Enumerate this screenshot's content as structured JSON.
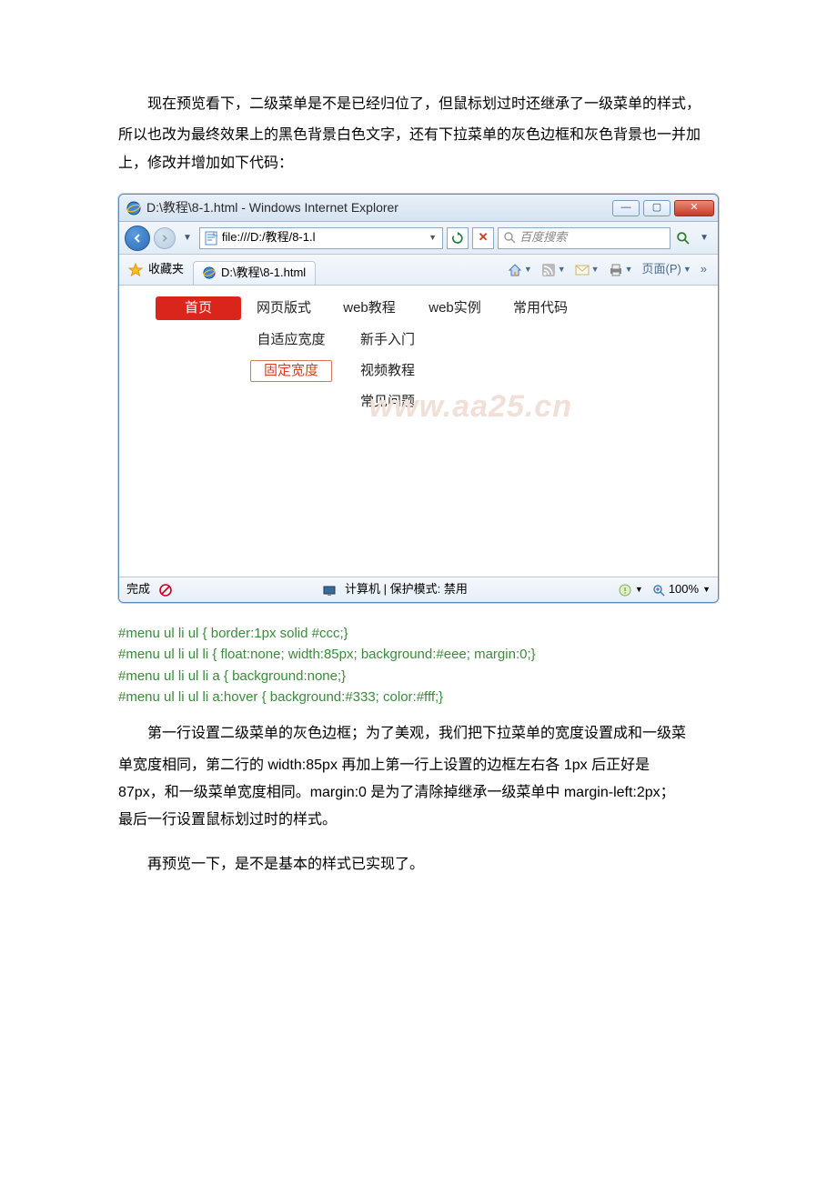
{
  "paragraphs": {
    "p1a": "现在预览看下，二级菜单是不是已经归位了，但鼠标划过时还继承了一级菜单的样式，",
    "p1b": "所以也改为最终效果上的黑色背景白色文字，还有下拉菜单的灰色边框和灰色背景也一并加",
    "p1c": "上，修改并增加如下代码：",
    "p2a": "第一行设置二级菜单的灰色边框；为了美观，我们把下拉菜单的宽度设置成和一级菜",
    "p2b": "单宽度相同，第二行的 width:85px 再加上第一行上设置的边框左右各 1px 后正好是",
    "p2c": "87px，和一级菜单宽度相同。margin:0 是为了清除掉继承一级菜单中 margin-left:2px；",
    "p2d": "最后一行设置鼠标划过时的样式。",
    "p3": "再预览一下，是不是基本的样式已实现了。"
  },
  "iewin": {
    "title": "D:\\教程\\8-1.html - Windows Internet Explorer",
    "address": "file:///D:/教程/8-1.l",
    "search_placeholder": "百度搜索",
    "fav_label": "收藏夹",
    "tab_label": "D:\\教程\\8-1.html",
    "page_menu": "页面(P)",
    "status_done": "完成",
    "status_zone": "计算机 | 保护模式: 禁用",
    "zoom": "100%"
  },
  "menu": {
    "items": [
      "首页",
      "网页版式",
      "web教程",
      "web实例",
      "常用代码"
    ],
    "sub_a": [
      "自适应宽度",
      "固定宽度"
    ],
    "sub_b": [
      "新手入门",
      "视频教程",
      "常见问题"
    ]
  },
  "watermark": "www.aa25.cn",
  "code": {
    "l1": "#menu ul li ul { border:1px solid #ccc;}",
    "l2": "#menu ul li ul li { float:none; width:85px; background:#eee; margin:0;}",
    "l3": "#menu ul li ul li a { background:none;}",
    "l4": "#menu ul li ul li a:hover { background:#333; color:#fff;}"
  }
}
